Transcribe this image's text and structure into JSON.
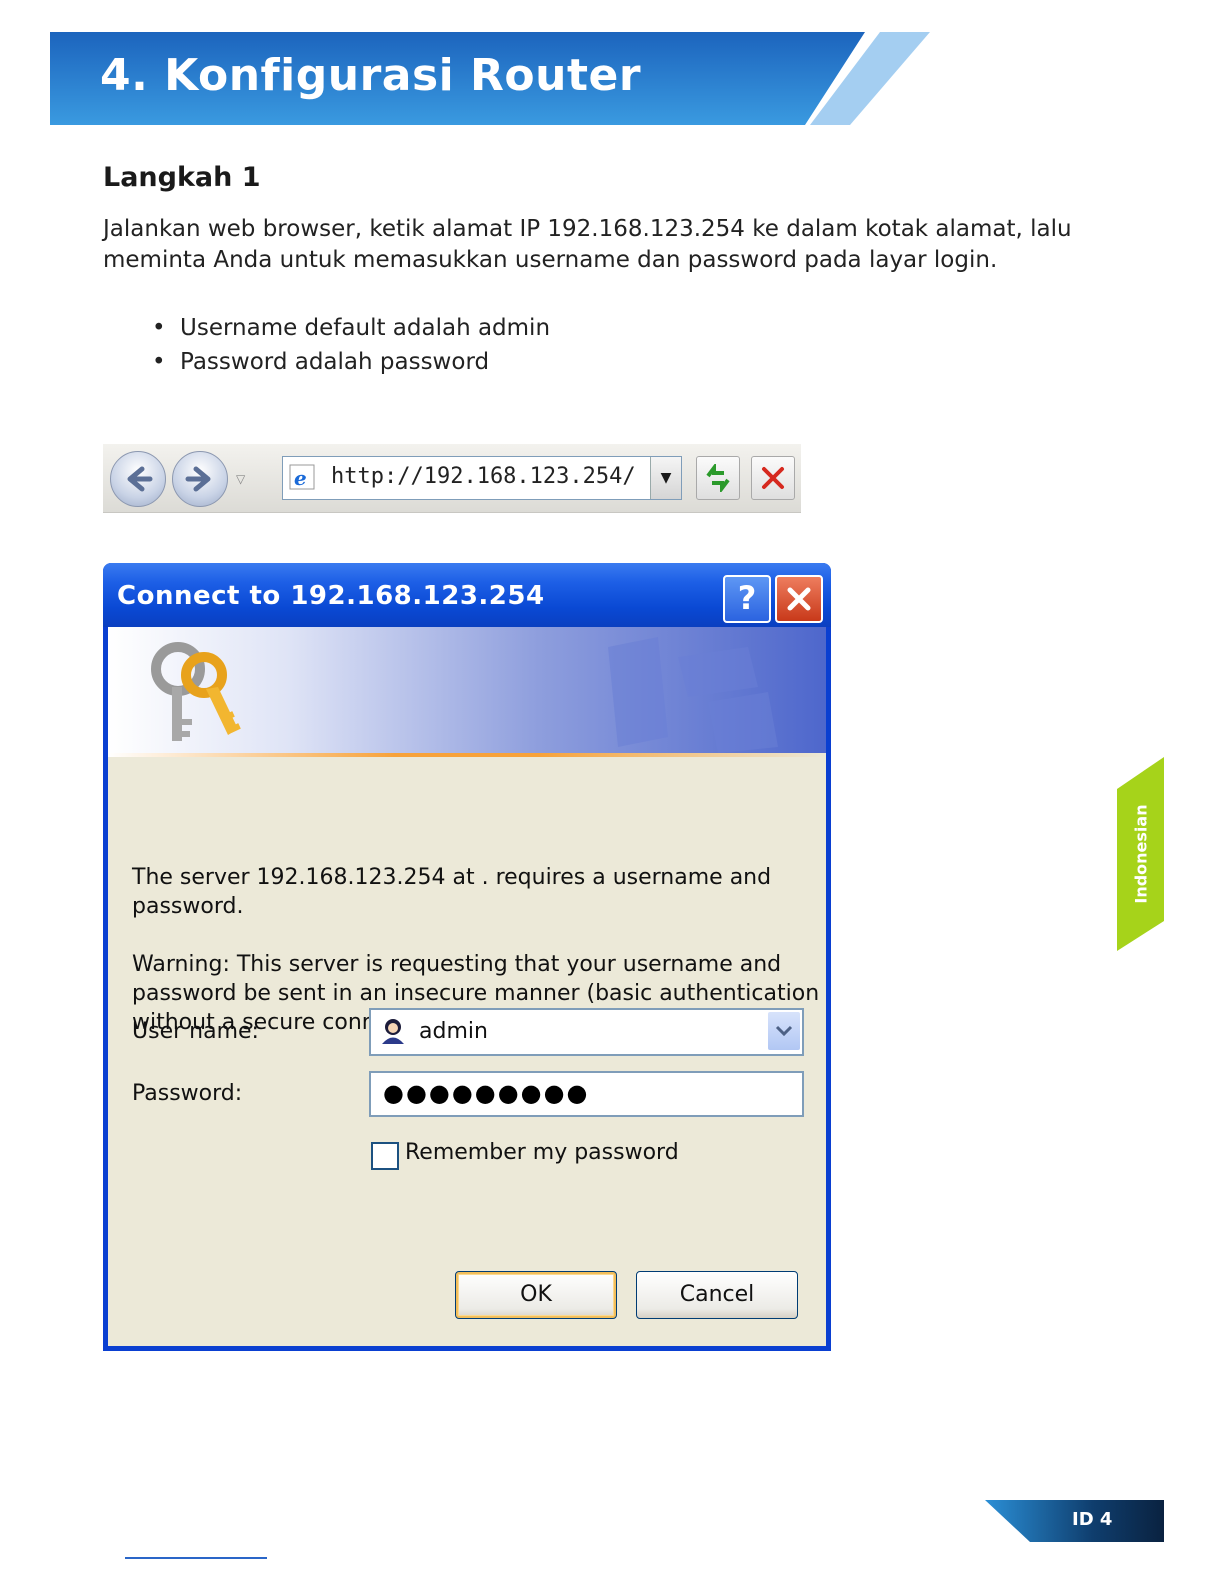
{
  "header": {
    "title": "4. Konfigurasi Router"
  },
  "step": {
    "title": "Langkah 1",
    "paragraph": "Jalankan web browser, ketik alamat IP 192.168.123.254 ke dalam kotak alamat, lalu meminta Anda untuk memasukkan username dan password pada layar login.",
    "bullets": [
      "Username default adalah admin",
      "Password adalah password"
    ]
  },
  "browser": {
    "url": "http://192.168.123.254/"
  },
  "dialog": {
    "title": "Connect to 192.168.123.254",
    "help_glyph": "?",
    "message": "The server 192.168.123.254 at . requires a username and password.",
    "warning": "Warning: This server is requesting that your username and password be sent in an insecure manner (basic authentication without a secure connection).",
    "username_label": "User name:",
    "username_value": "admin",
    "password_label": "Password:",
    "password_value": "●●●●●●●●●",
    "remember_label": "Remember my password",
    "remember_checked": false,
    "ok_label": "OK",
    "cancel_label": "Cancel"
  },
  "side_tab": {
    "label": "Indonesian"
  },
  "page_number": "ID 4",
  "colors": {
    "header_blue": "#1f73c9",
    "side_green": "#a6d31a",
    "dialog_blue": "#0a49d4",
    "dialog_body": "#ece9d8"
  }
}
